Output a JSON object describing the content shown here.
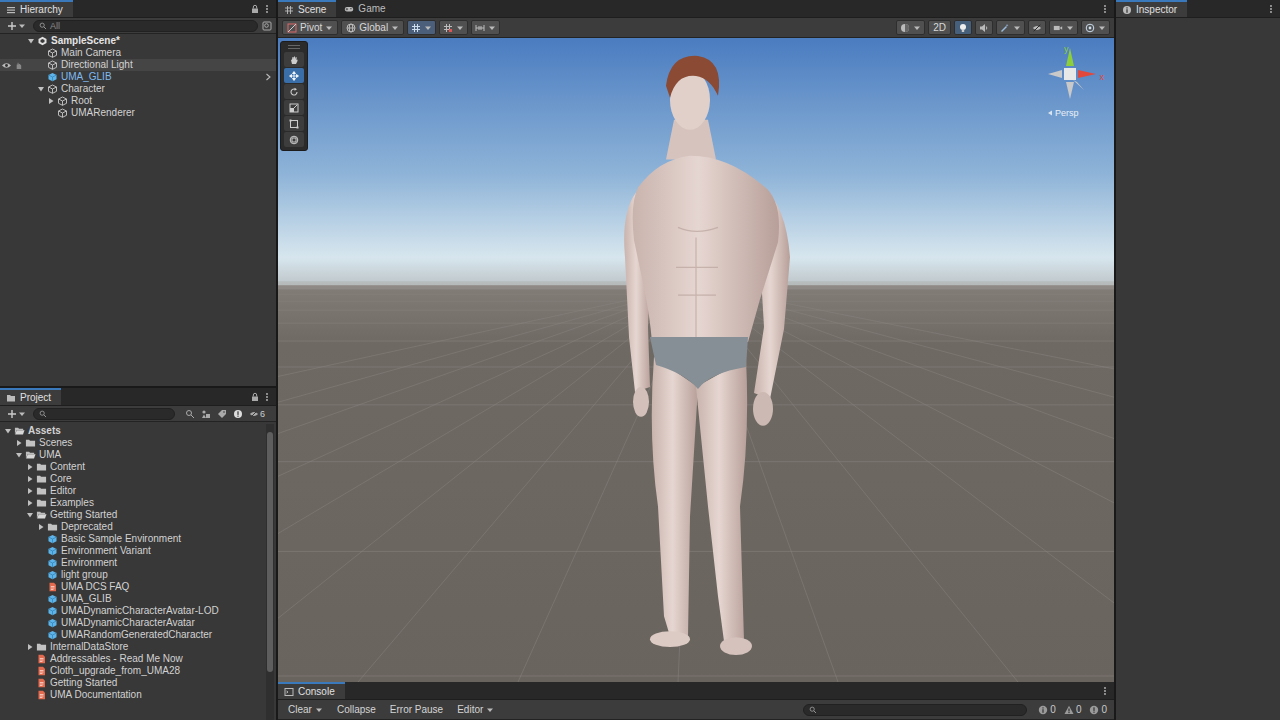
{
  "hierarchy": {
    "title": "Hierarchy",
    "search_placeholder": "All",
    "items": [
      {
        "label": "SampleScene*",
        "depth": 0,
        "kind": "scene",
        "has_children": true,
        "expanded": true,
        "hovered": false
      },
      {
        "label": "Main Camera",
        "depth": 1,
        "kind": "object",
        "has_children": false,
        "expanded": false,
        "hovered": false
      },
      {
        "label": "Directional Light",
        "depth": 1,
        "kind": "object",
        "has_children": false,
        "expanded": false,
        "hovered": true
      },
      {
        "label": "UMA_GLIB",
        "depth": 1,
        "kind": "prefab",
        "has_children": false,
        "expanded": false,
        "hovered": false
      },
      {
        "label": "Character",
        "depth": 1,
        "kind": "object",
        "has_children": true,
        "expanded": true,
        "hovered": false
      },
      {
        "label": "Root",
        "depth": 2,
        "kind": "object",
        "has_children": true,
        "expanded": false,
        "hovered": false
      },
      {
        "label": "UMARenderer",
        "depth": 2,
        "kind": "object",
        "has_children": false,
        "expanded": false,
        "hovered": false
      }
    ]
  },
  "scene_view": {
    "tabs": [
      {
        "label": "Scene",
        "selected": true
      },
      {
        "label": "Game",
        "selected": false
      }
    ],
    "toolbar": {
      "pivot": "Pivot",
      "global": "Global",
      "two_d": "2D",
      "lighting_on": true
    },
    "tools": [
      {
        "kind": "hand",
        "selected": false
      },
      {
        "kind": "move",
        "selected": true
      },
      {
        "kind": "rotate",
        "selected": false
      },
      {
        "kind": "scale",
        "selected": false
      },
      {
        "kind": "rect",
        "selected": false
      },
      {
        "kind": "transform",
        "selected": false
      }
    ],
    "gizmo": {
      "y": "y",
      "x": "x",
      "projection": "Persp"
    }
  },
  "inspector": {
    "title": "Inspector"
  },
  "project": {
    "title": "Project",
    "hidden_count": "6",
    "items": [
      {
        "label": "Assets",
        "depth": 0,
        "kind": "folder",
        "has_children": true,
        "expanded": true
      },
      {
        "label": "Scenes",
        "depth": 1,
        "kind": "folder",
        "has_children": true,
        "expanded": false
      },
      {
        "label": "UMA",
        "depth": 1,
        "kind": "folder",
        "has_children": true,
        "expanded": true
      },
      {
        "label": "Content",
        "depth": 2,
        "kind": "folder",
        "has_children": true,
        "expanded": false
      },
      {
        "label": "Core",
        "depth": 2,
        "kind": "folder",
        "has_children": true,
        "expanded": false
      },
      {
        "label": "Editor",
        "depth": 2,
        "kind": "folder",
        "has_children": true,
        "expanded": false
      },
      {
        "label": "Examples",
        "depth": 2,
        "kind": "folder",
        "has_children": true,
        "expanded": false
      },
      {
        "label": "Getting Started",
        "depth": 2,
        "kind": "folder",
        "has_children": true,
        "expanded": true
      },
      {
        "label": "Deprecated",
        "depth": 3,
        "kind": "folder",
        "has_children": true,
        "expanded": false
      },
      {
        "label": "Basic Sample Environment",
        "depth": 3,
        "kind": "prefab",
        "has_children": false,
        "expanded": false
      },
      {
        "label": "Environment Variant",
        "depth": 3,
        "kind": "prefab",
        "has_children": false,
        "expanded": false
      },
      {
        "label": "Environment",
        "depth": 3,
        "kind": "prefab",
        "has_children": false,
        "expanded": false
      },
      {
        "label": "light group",
        "depth": 3,
        "kind": "prefab",
        "has_children": false,
        "expanded": false
      },
      {
        "label": "UMA DCS FAQ",
        "depth": 3,
        "kind": "doc",
        "has_children": false,
        "expanded": false
      },
      {
        "label": "UMA_GLIB",
        "depth": 3,
        "kind": "prefab",
        "has_children": false,
        "expanded": false
      },
      {
        "label": "UMADynamicCharacterAvatar-LOD",
        "depth": 3,
        "kind": "prefab",
        "has_children": false,
        "expanded": false
      },
      {
        "label": "UMADynamicCharacterAvatar",
        "depth": 3,
        "kind": "prefab",
        "has_children": false,
        "expanded": false
      },
      {
        "label": "UMARandomGeneratedCharacter",
        "depth": 3,
        "kind": "prefab",
        "has_children": false,
        "expanded": false
      },
      {
        "label": "InternalDataStore",
        "depth": 2,
        "kind": "folder",
        "has_children": true,
        "expanded": false
      },
      {
        "label": "Addressables - Read Me Now",
        "depth": 2,
        "kind": "doc",
        "has_children": false,
        "expanded": false
      },
      {
        "label": "Cloth_upgrade_from_UMA28",
        "depth": 2,
        "kind": "doc",
        "has_children": false,
        "expanded": false
      },
      {
        "label": "Getting Started",
        "depth": 2,
        "kind": "doc",
        "has_children": false,
        "expanded": false
      },
      {
        "label": "UMA Documentation",
        "depth": 2,
        "kind": "doc",
        "has_children": false,
        "expanded": false
      }
    ]
  },
  "console": {
    "title": "Console",
    "buttons": [
      {
        "label": "Clear",
        "dropdown": true
      },
      {
        "label": "Collapse",
        "dropdown": false
      },
      {
        "label": "Error Pause",
        "dropdown": false
      },
      {
        "label": "Editor",
        "dropdown": true
      }
    ],
    "counts": [
      {
        "kind": "info",
        "count": "0"
      },
      {
        "kind": "warning",
        "count": "0"
      },
      {
        "kind": "error",
        "count": "0"
      }
    ]
  }
}
